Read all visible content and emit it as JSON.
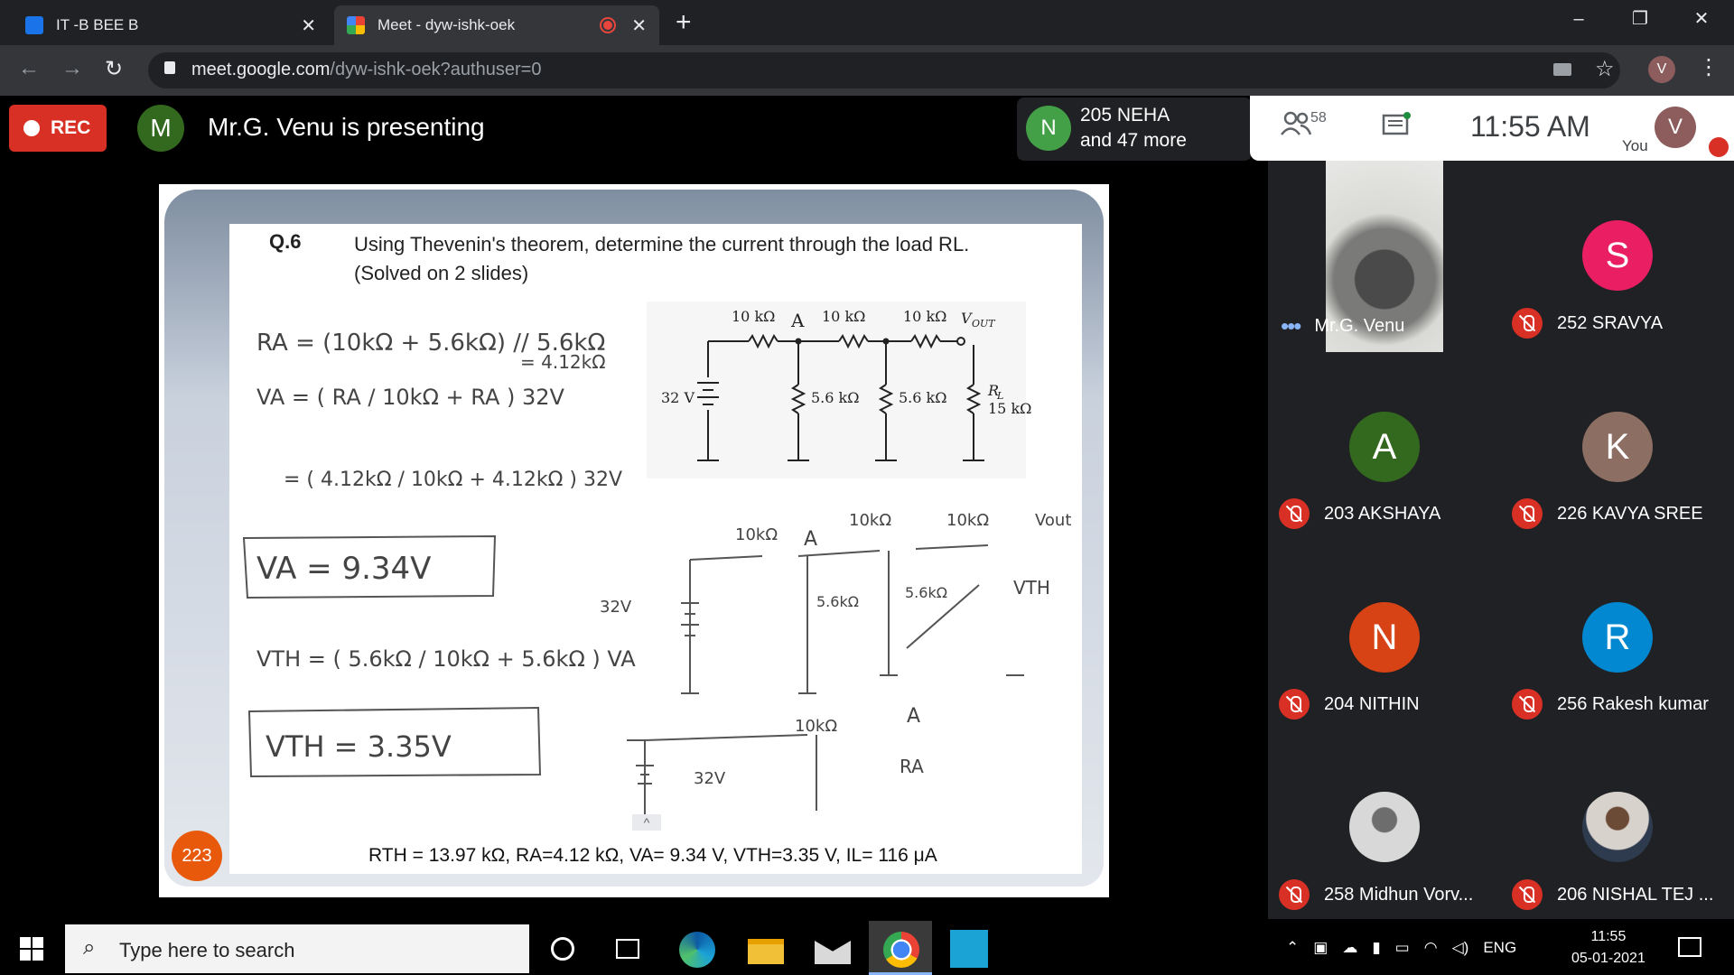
{
  "browser": {
    "tabs": [
      {
        "title": "IT -B BEE B",
        "close": "✕"
      },
      {
        "title": "Meet - dyw-ishk-oek",
        "close": "✕"
      }
    ],
    "new_tab": "+",
    "url_host": "meet.google.com",
    "url_path": "/dyw-ishk-oek?authuser=0",
    "profile_initial": "V",
    "window_controls": {
      "minimize": "–",
      "restore": "❐",
      "close": "✕"
    }
  },
  "meet": {
    "rec_label": "REC",
    "presenter_initial": "M",
    "presenting_text": "Mr.G. Venu is presenting",
    "attendees_initial": "N",
    "attendees_line1": "205 NEHA",
    "attendees_line2": "and 47 more",
    "people_count": "58",
    "clock": "11:55 AM",
    "you_initial": "V",
    "you_label": "You",
    "page_badge": "223"
  },
  "slide": {
    "question_label": "Q.6",
    "question_line1": "Using Thevenin's theorem, determine the current through the load RL.",
    "question_line2": "(Solved on 2 slides)",
    "answer_line": "RTH = 13.97 kΩ, RA=4.12 kΩ, VA= 9.34 V, VTH=3.35 V, IL= 116 μA",
    "circuit_labels": {
      "r1": "10 kΩ",
      "node": "A",
      "r2": "10 kΩ",
      "r3": "10 kΩ",
      "vout": "V",
      "vout_sub": "OUT",
      "src": "32 V",
      "r4": "5.6 kΩ",
      "r5": "5.6 kΩ",
      "rl": "R",
      "rl_sub": "L",
      "rl_val": "15 kΩ"
    },
    "handwriting": {
      "ra_eq": "RA = (10kΩ + 5.6kΩ) // 5.6kΩ",
      "ra_val": "= 4.12kΩ",
      "va_eq": "VA = ( RA / 10kΩ + RA ) 32V",
      "va_step": "= ( 4.12kΩ / 10kΩ + 4.12kΩ ) 32V",
      "va_result": "VA = 9.34V",
      "vth_eq": "VTH = ( 5.6kΩ / 10kΩ + 5.6kΩ ) VA",
      "vth_result": "VTH = 3.35V",
      "c2_r1": "10kΩ",
      "c2_a": "A",
      "c2_r2": "10kΩ",
      "c2_r3": "10kΩ",
      "c2_vout": "Vout",
      "c2_src": "32V",
      "c2_r4": "5.6kΩ",
      "c2_r5": "5.6kΩ",
      "c2_vth": "VTH",
      "c3_r1": "10kΩ",
      "c3_a": "A",
      "c3_src": "32V",
      "c3_ra": "RA"
    }
  },
  "participants": [
    {
      "name": "Mr.G. Venu",
      "type": "video"
    },
    {
      "name": "252 SRAVYA",
      "initial": "S",
      "color": "#e91e63"
    },
    {
      "name": "203 AKSHAYA",
      "initial": "A",
      "color": "#33691e"
    },
    {
      "name": "226 KAVYA SREE",
      "initial": "K",
      "color": "#8d6e63"
    },
    {
      "name": "204 NITHIN",
      "initial": "N",
      "color": "#d84315"
    },
    {
      "name": "256 Rakesh kumar",
      "initial": "R",
      "color": "#0288d1"
    },
    {
      "name": "258 Midhun Vorv...",
      "type": "photo"
    },
    {
      "name": "206 NISHAL TEJ ...",
      "type": "photo"
    }
  ],
  "taskbar": {
    "search_placeholder": "Type here to search",
    "language": "ENG",
    "time": "11:55",
    "date": "05-01-2021"
  }
}
